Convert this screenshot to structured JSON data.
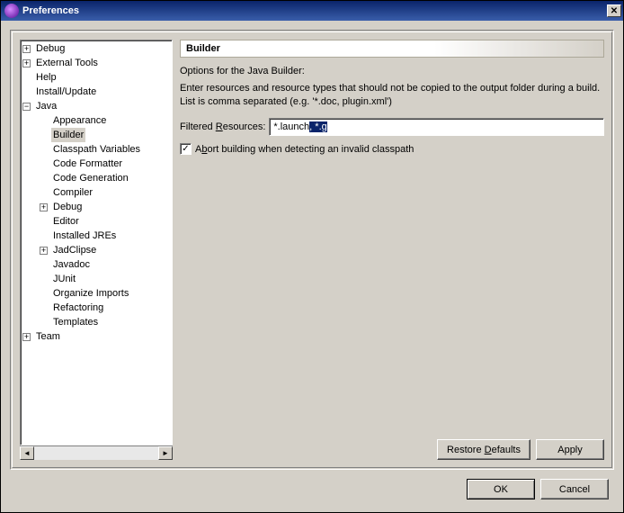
{
  "window": {
    "title": "Preferences"
  },
  "tree": {
    "items": [
      {
        "label": "Debug",
        "expander": "+",
        "depth": 0
      },
      {
        "label": "External Tools",
        "expander": "+",
        "depth": 0
      },
      {
        "label": "Help",
        "expander": "",
        "depth": 0
      },
      {
        "label": "Install/Update",
        "expander": "",
        "depth": 0
      },
      {
        "label": "Java",
        "expander": "−",
        "depth": 0
      },
      {
        "label": "Appearance",
        "expander": "",
        "depth": 1
      },
      {
        "label": "Builder",
        "expander": "",
        "depth": 1,
        "selected": true
      },
      {
        "label": "Classpath Variables",
        "expander": "",
        "depth": 1
      },
      {
        "label": "Code Formatter",
        "expander": "",
        "depth": 1
      },
      {
        "label": "Code Generation",
        "expander": "",
        "depth": 1
      },
      {
        "label": "Compiler",
        "expander": "",
        "depth": 1
      },
      {
        "label": "Debug",
        "expander": "+",
        "depth": 1
      },
      {
        "label": "Editor",
        "expander": "",
        "depth": 1
      },
      {
        "label": "Installed JREs",
        "expander": "",
        "depth": 1
      },
      {
        "label": "JadClipse",
        "expander": "+",
        "depth": 1
      },
      {
        "label": "Javadoc",
        "expander": "",
        "depth": 1
      },
      {
        "label": "JUnit",
        "expander": "",
        "depth": 1
      },
      {
        "label": "Organize Imports",
        "expander": "",
        "depth": 1
      },
      {
        "label": "Refactoring",
        "expander": "",
        "depth": 1
      },
      {
        "label": "Templates",
        "expander": "",
        "depth": 1
      },
      {
        "label": "Team",
        "expander": "+",
        "depth": 0
      }
    ]
  },
  "page": {
    "heading": "Builder",
    "subheading": "Options for the Java Builder:",
    "description": "Enter resources and resource types that should not be copied to the output folder during a build. List is comma separated (e.g. '*.doc, plugin.xml')",
    "filtered_label_pre": "Filtered ",
    "filtered_label_u": "R",
    "filtered_label_post": "esources:",
    "filtered_value_plain": "*.launch",
    "filtered_value_selected": ", *.g",
    "abort_pre": "A",
    "abort_u": "b",
    "abort_post": "ort building when detecting an invalid classpath",
    "abort_checked": true
  },
  "buttons": {
    "restore_pre": "Restore ",
    "restore_u": "D",
    "restore_post": "efaults",
    "apply": "Apply",
    "ok": "OK",
    "cancel": "Cancel"
  }
}
